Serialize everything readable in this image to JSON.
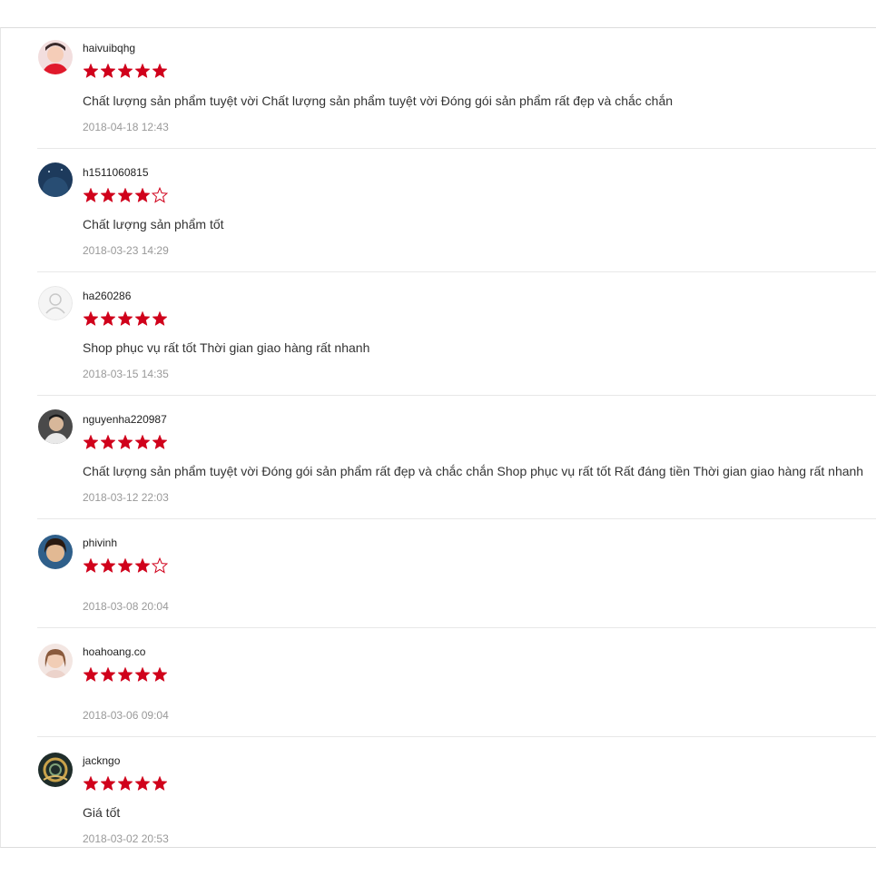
{
  "reviews": [
    {
      "username": "haivuibqhg",
      "rating": 5,
      "comment": " Chất lượng sản phẩm tuyệt vời Chất lượng sản phẩm tuyệt vời Đóng gói sản phẩm rất đẹp và chắc chắn",
      "date": "2018-04-18 12:43",
      "avatar": "girl-photo-avatar"
    },
    {
      "username": "h1511060815",
      "rating": 4,
      "comment": " Chất lượng sản phẩm tốt",
      "date": "2018-03-23 14:29",
      "avatar": "night-sky-avatar"
    },
    {
      "username": "ha260286",
      "rating": 5,
      "comment": " Shop phục vụ rất tốt Thời gian giao hàng rất nhanh",
      "date": "2018-03-15 14:35",
      "avatar": "default-user-avatar"
    },
    {
      "username": "nguyenha220987",
      "rating": 5,
      "comment": " Chất lượng sản phẩm tuyệt vời Đóng gói sản phẩm rất đẹp và chắc chắn Shop phục vụ rất tốt Rất đáng tiền Thời gian giao hàng rất nhanh",
      "date": "2018-03-12 22:03",
      "avatar": "man-photo-avatar"
    },
    {
      "username": "phivinh",
      "rating": 4,
      "comment": "",
      "date": "2018-03-08 20:04",
      "avatar": "child-photo-avatar"
    },
    {
      "username": "hoahoang.co",
      "rating": 5,
      "comment": "",
      "date": "2018-03-06 09:04",
      "avatar": "woman-photo-avatar"
    },
    {
      "username": "jackngo",
      "rating": 5,
      "comment": "Giá tốt",
      "date": "2018-03-02 20:53",
      "avatar": "artwork-avatar"
    }
  ],
  "colors": {
    "star": "#d0011b",
    "date": "#999999",
    "divider": "#e8e8e8"
  }
}
